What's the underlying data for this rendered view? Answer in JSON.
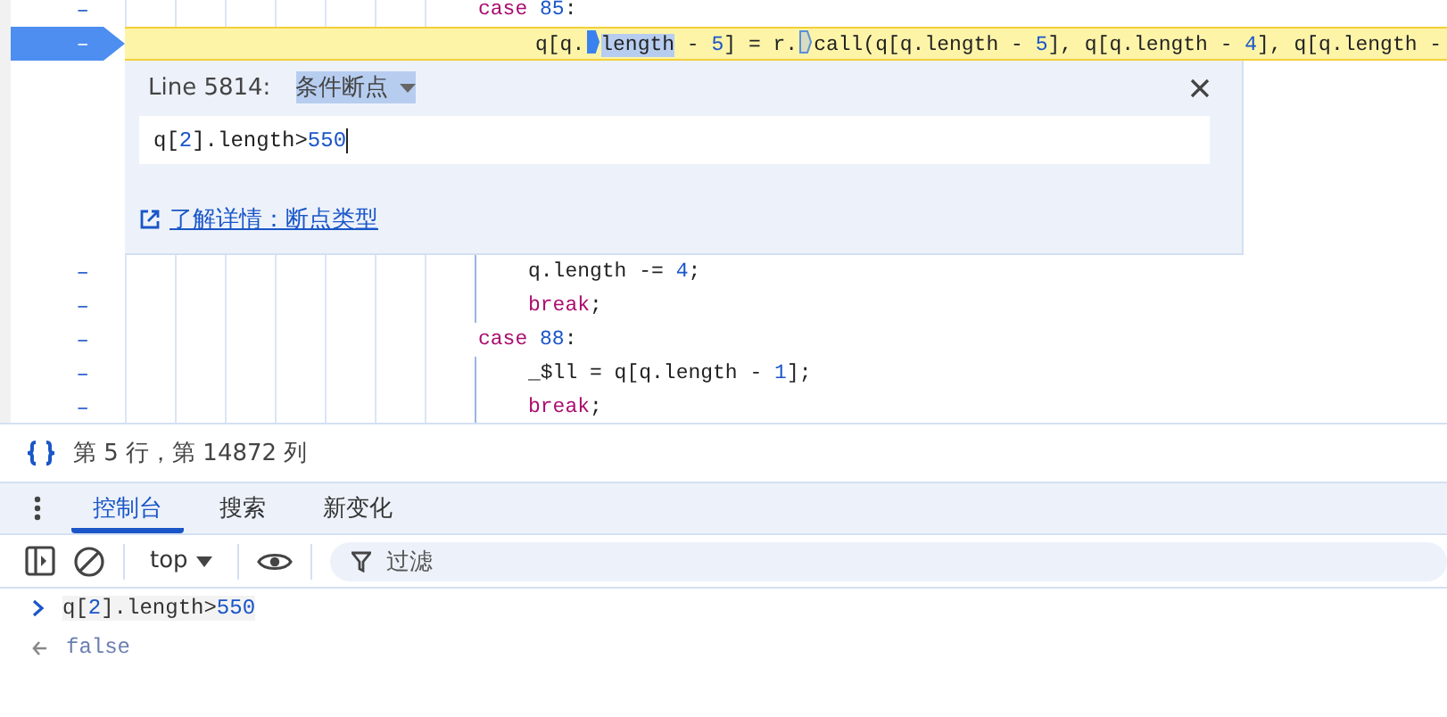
{
  "editor": {
    "lines": [
      {
        "gutter": "–",
        "kind": "case",
        "breakpoint": false,
        "tokens": [
          {
            "kind": "keyword",
            "text": "case "
          },
          {
            "kind": "number",
            "text": "85"
          },
          {
            "kind": "plain",
            "text": ":"
          }
        ]
      },
      {
        "gutter": "–",
        "kind": "body",
        "breakpoint": true,
        "tokens": [
          {
            "kind": "plain",
            "text": "q[q."
          },
          {
            "kind": "marker",
            "active": true
          },
          {
            "kind": "selection",
            "text": "length"
          },
          {
            "kind": "plain",
            "text": " - "
          },
          {
            "kind": "number",
            "text": "5"
          },
          {
            "kind": "plain",
            "text": "] = r."
          },
          {
            "kind": "marker",
            "active": false
          },
          {
            "kind": "plain",
            "text": "call(q[q.length - "
          },
          {
            "kind": "number",
            "text": "5"
          },
          {
            "kind": "plain",
            "text": "], q[q.length - "
          },
          {
            "kind": "number",
            "text": "4"
          },
          {
            "kind": "plain",
            "text": "], q[q.length -"
          }
        ]
      },
      {
        "kind": "dialog"
      },
      {
        "gutter": "–",
        "kind": "body",
        "breakpoint": false,
        "tokens": [
          {
            "kind": "plain",
            "text": "q.length -= "
          },
          {
            "kind": "number",
            "text": "4"
          },
          {
            "kind": "plain",
            "text": ";"
          }
        ]
      },
      {
        "gutter": "–",
        "kind": "body",
        "breakpoint": false,
        "tokens": [
          {
            "kind": "keyword",
            "text": "break"
          },
          {
            "kind": "plain",
            "text": ";"
          }
        ]
      },
      {
        "gutter": "–",
        "kind": "case",
        "breakpoint": false,
        "tokens": [
          {
            "kind": "keyword",
            "text": "case "
          },
          {
            "kind": "number",
            "text": "88"
          },
          {
            "kind": "plain",
            "text": ":"
          }
        ]
      },
      {
        "gutter": "–",
        "kind": "body",
        "breakpoint": false,
        "tokens": [
          {
            "kind": "plain",
            "text": "_$ll = q[q.length - "
          },
          {
            "kind": "number",
            "text": "1"
          },
          {
            "kind": "plain",
            "text": "];"
          }
        ]
      },
      {
        "gutter": "–",
        "kind": "body",
        "breakpoint": false,
        "tokens": [
          {
            "kind": "keyword",
            "text": "break"
          },
          {
            "kind": "plain",
            "text": ";"
          }
        ]
      }
    ]
  },
  "breakpoint_dialog": {
    "line_label": "Line 5814:",
    "type": "条件断点",
    "condition": [
      {
        "kind": "plain",
        "text": "q["
      },
      {
        "kind": "number",
        "text": "2"
      },
      {
        "kind": "plain",
        "text": "].length>"
      },
      {
        "kind": "number",
        "text": "550"
      }
    ],
    "link": "了解详情：断点类型"
  },
  "status_bar": {
    "position": "第 5 行，第 14872 列"
  },
  "drawer": {
    "tabs": [
      {
        "label": "控制台",
        "selected": true
      },
      {
        "label": "搜索",
        "selected": false
      },
      {
        "label": "新变化",
        "selected": false
      }
    ],
    "toolbar": {
      "context": "top",
      "filter_placeholder": "过滤"
    },
    "console": [
      {
        "kind": "input",
        "tokens": [
          {
            "kind": "plain",
            "text": "q["
          },
          {
            "kind": "number",
            "text": "2"
          },
          {
            "kind": "plain",
            "text": "].length>"
          },
          {
            "kind": "number",
            "text": "550"
          }
        ]
      },
      {
        "kind": "result",
        "tokens": [
          {
            "kind": "result",
            "text": "false"
          }
        ]
      }
    ]
  }
}
